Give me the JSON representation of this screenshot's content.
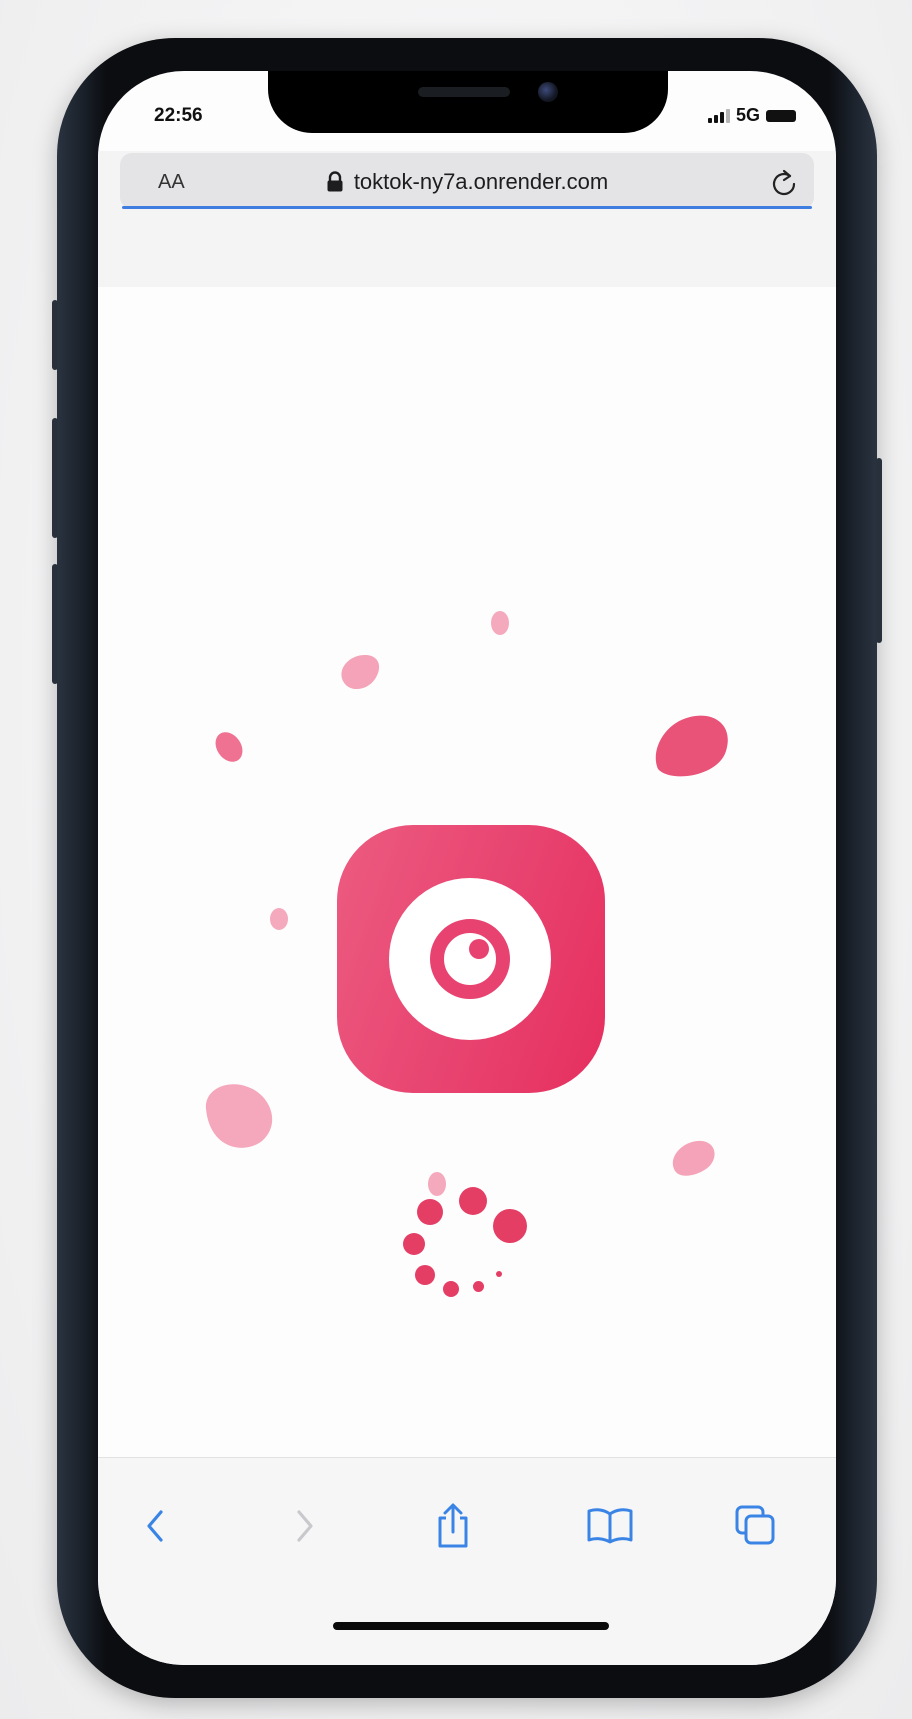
{
  "status_bar": {
    "time": "22:56",
    "network": "5G"
  },
  "address_bar": {
    "text_size_label": "AA",
    "url": "toktok-ny7a.onrender.com",
    "secure": true
  },
  "page": {
    "state": "loading",
    "logo_icon": "camera-lens-icon",
    "accent_color": "#e84370",
    "loading_indicator": "dot-spinner"
  },
  "bottom_toolbar": {
    "buttons": [
      {
        "name": "back-button",
        "icon": "chevron-left-icon",
        "enabled": true
      },
      {
        "name": "forward-button",
        "icon": "chevron-right-icon",
        "enabled": false
      },
      {
        "name": "share-button",
        "icon": "share-icon",
        "enabled": true
      },
      {
        "name": "bookmarks-button",
        "icon": "book-icon",
        "enabled": true
      },
      {
        "name": "tabs-button",
        "icon": "tabs-icon",
        "enabled": true
      }
    ]
  },
  "colors": {
    "toolbar_icon": "#3a84e6",
    "toolbar_icon_disabled": "#c9c9cd",
    "progress_bar": "#3f7de0"
  }
}
